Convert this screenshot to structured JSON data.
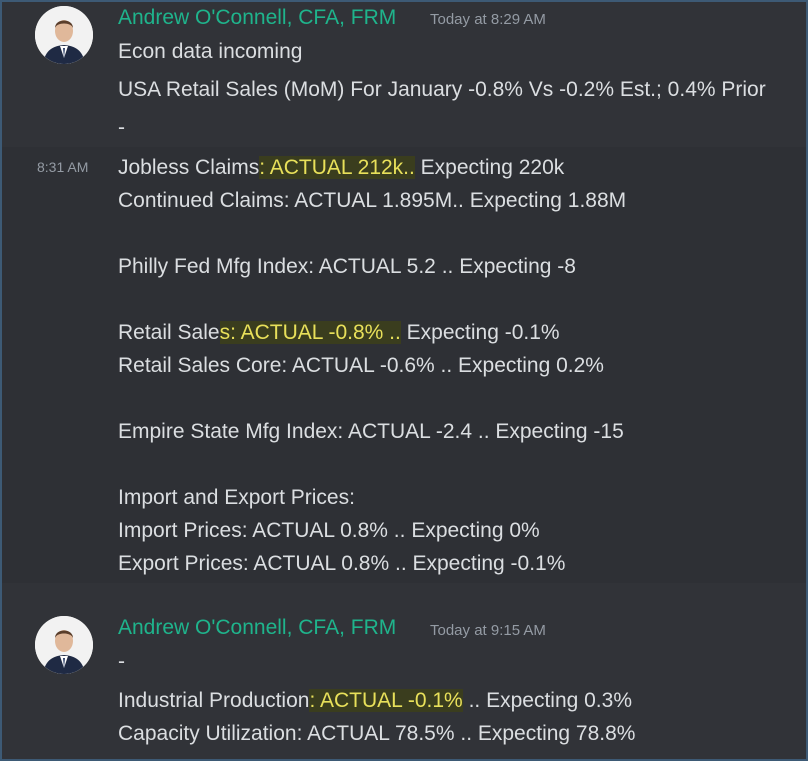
{
  "message1": {
    "author": "Andrew O'Connell, CFA, FRM",
    "timestamp": "Today at 8:29 AM",
    "lines": [
      "Econ data incoming",
      "USA Retail Sales (MoM) For January -0.8% Vs -0.2% Est.; 0.4% Prior",
      "-"
    ]
  },
  "message2": {
    "timestamp": "8:31 AM",
    "jobless": {
      "pre": "Jobless Claims",
      "hl": ": ACTUAL 212k..",
      "post": " Expecting 220k"
    },
    "continued": "Continued Claims: ACTUAL 1.895M.. Expecting 1.88M",
    "philly": "Philly Fed Mfg Index: ACTUAL 5.2 .. Expecting -8",
    "retail": {
      "pre": "Retail Sale",
      "hl": "s: ACTUAL -0.8% ..",
      "post": " Expecting -0.1%"
    },
    "retail_core": "Retail Sales Core: ACTUAL -0.6% .. Expecting 0.2%",
    "empire": "Empire State Mfg Index: ACTUAL -2.4 .. Expecting -15",
    "import_export_title": "Import and Export Prices:",
    "import_prices": "Import Prices: ACTUAL 0.8% .. Expecting 0%",
    "export_prices": "Export Prices: ACTUAL 0.8% .. Expecting -0.1%"
  },
  "message3": {
    "author": "Andrew O'Connell, CFA, FRM",
    "timestamp": "Today at 9:15 AM",
    "dash": "-",
    "industrial": {
      "pre": "Industrial Production",
      "hl": ": ACTUAL -0.1%",
      "post": " .. Expecting 0.3%"
    },
    "capacity": "Capacity Utilization: ACTUAL 78.5% .. Expecting 78.8%"
  },
  "colors": {
    "author": "#1fb48c",
    "highlight_bg": "#3a3d1e",
    "highlight_text": "#e8e05a",
    "background": "#313338"
  },
  "icons": {
    "avatar": "profile-photo"
  }
}
